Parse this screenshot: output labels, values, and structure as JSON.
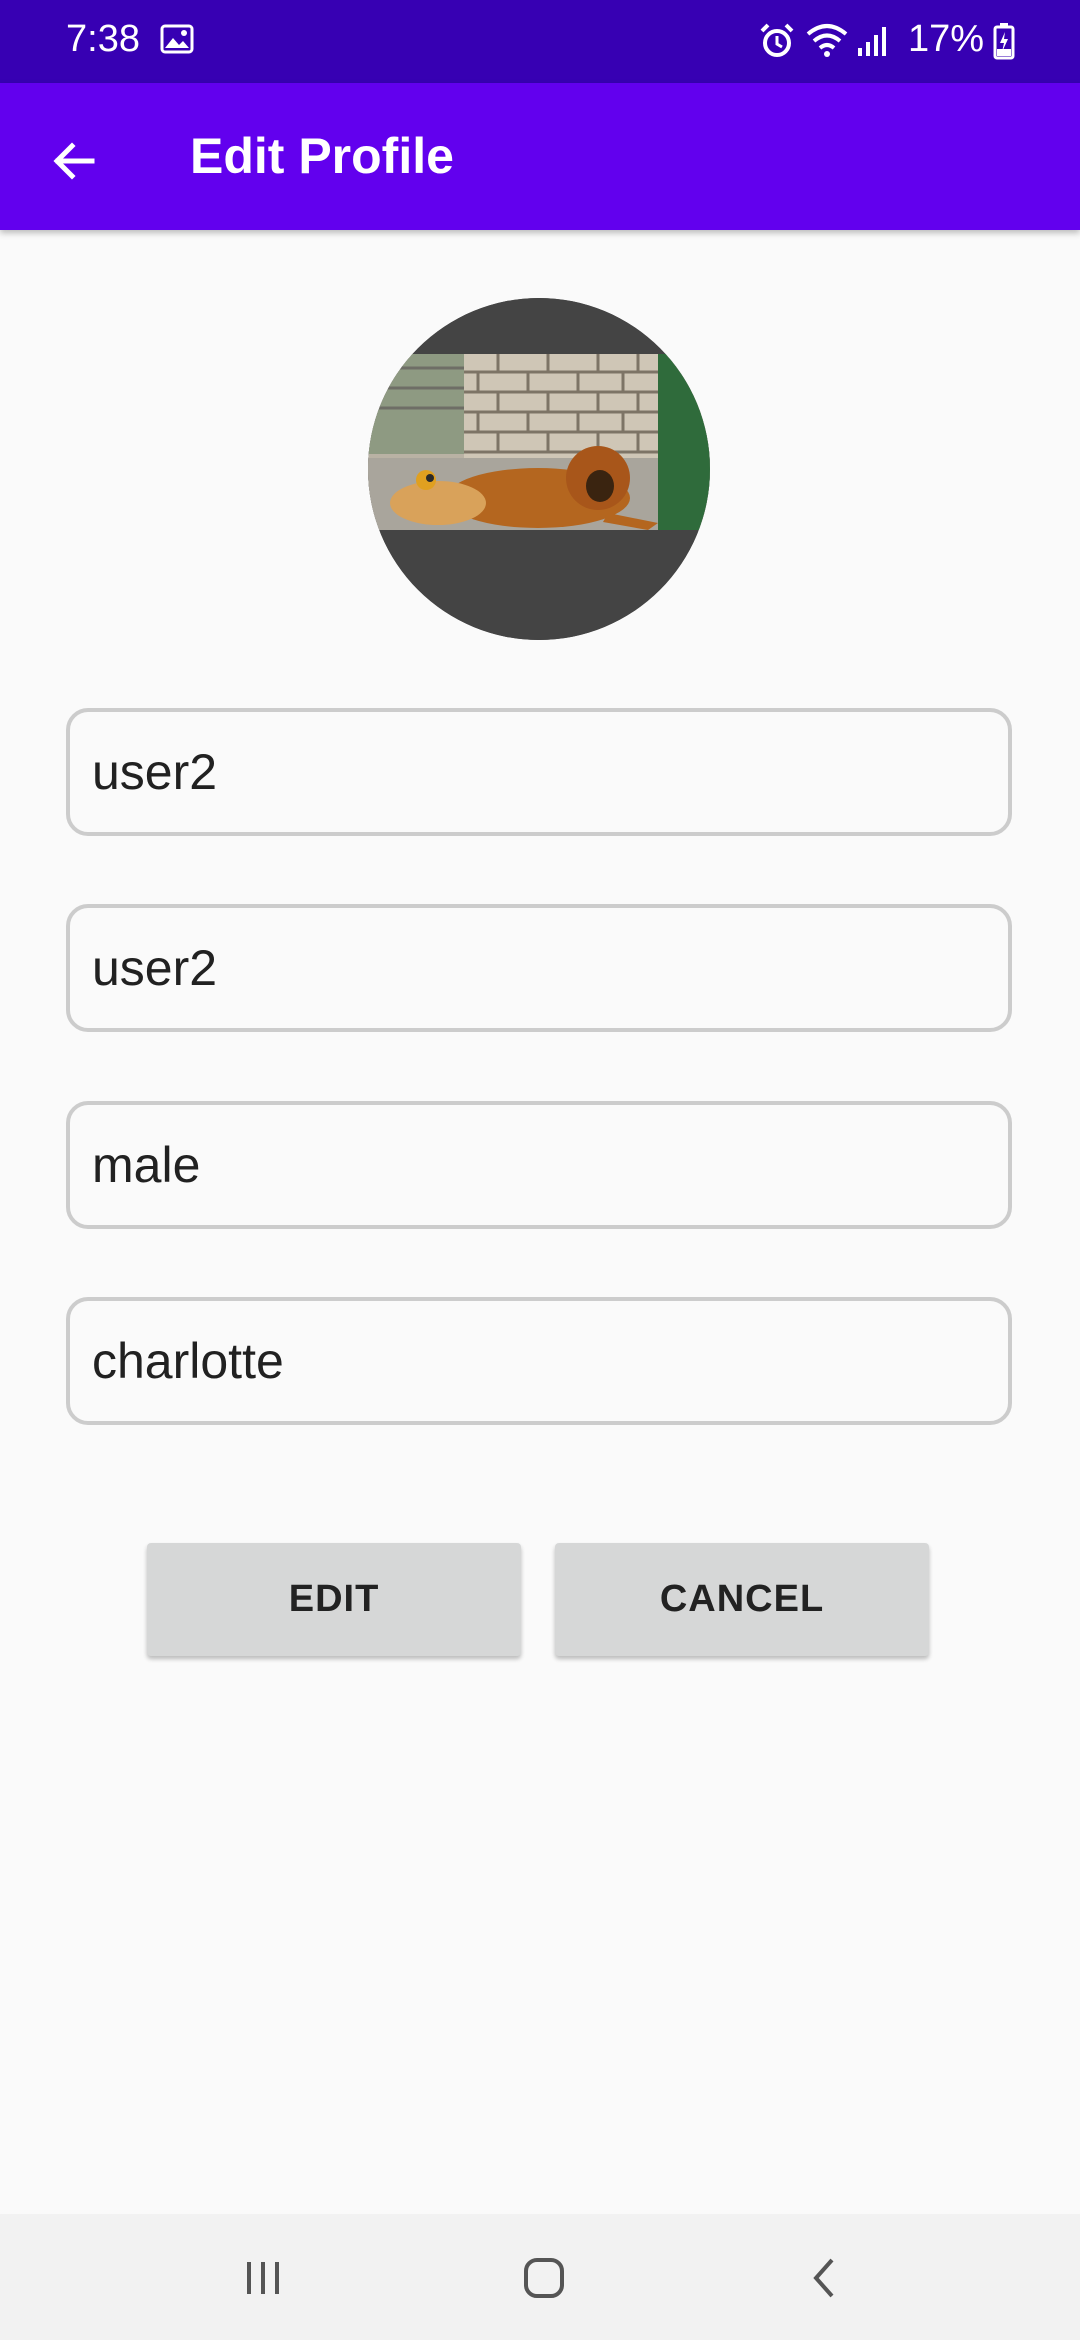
{
  "status_bar": {
    "time": "7:38",
    "battery": "17%",
    "icons": [
      "gallery-icon",
      "alarm-icon",
      "wifi-icon",
      "signal-icon",
      "battery-icon"
    ]
  },
  "app_bar": {
    "title": "Edit Profile",
    "back_icon": "arrow-left-icon"
  },
  "avatar": {
    "image": "dog lying by brick wall"
  },
  "form": {
    "fields": [
      {
        "value": "user2"
      },
      {
        "value": "user2"
      },
      {
        "value": "male"
      },
      {
        "value": "charlotte"
      }
    ]
  },
  "buttons": {
    "edit_label": "EDIT",
    "cancel_label": "CANCEL"
  },
  "nav_bar": {
    "icons": [
      "recent-apps-icon",
      "home-icon",
      "back-icon"
    ]
  },
  "colors": {
    "status_bar": "#3700b3",
    "app_bar": "#6200ee",
    "background": "#fafafa",
    "field_border": "#cccccc",
    "button": "#d6d7d7"
  }
}
